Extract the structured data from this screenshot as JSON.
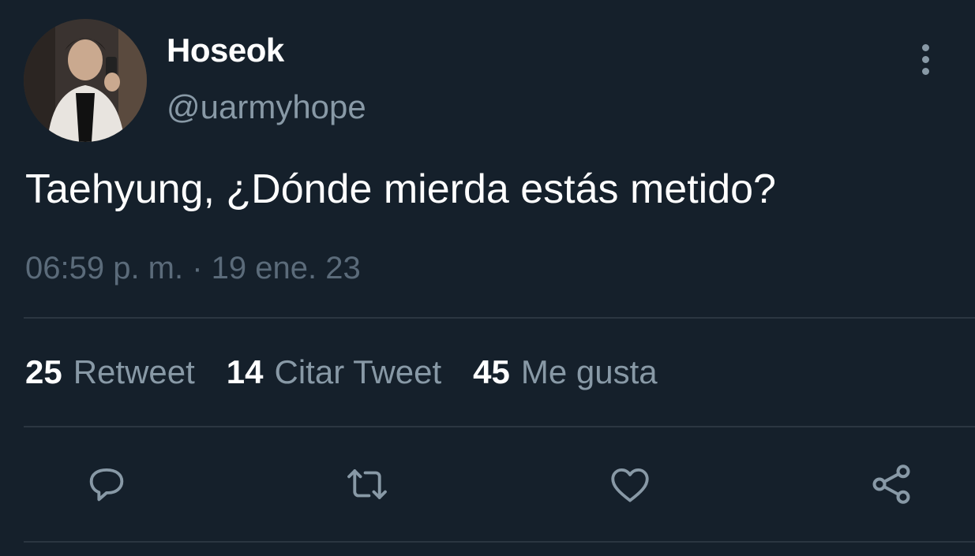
{
  "tweet": {
    "author": {
      "display_name": "Hoseok",
      "handle": "@uarmyhope"
    },
    "text": "Taehyung, ¿Dónde mierda estás metido?",
    "timestamp": "06:59 p. m. · 19 ene. 23",
    "stats": [
      {
        "count": "25",
        "label": "Retweet"
      },
      {
        "count": "14",
        "label": "Citar Tweet"
      },
      {
        "count": "45",
        "label": "Me gusta"
      }
    ]
  },
  "actions": [
    "reply-icon",
    "retweet-icon",
    "like-icon",
    "share-icon"
  ],
  "colors": {
    "background": "#15202b",
    "secondary_text": "#8899a6",
    "divider": "#2b3641",
    "primary_text": "#ffffff"
  }
}
